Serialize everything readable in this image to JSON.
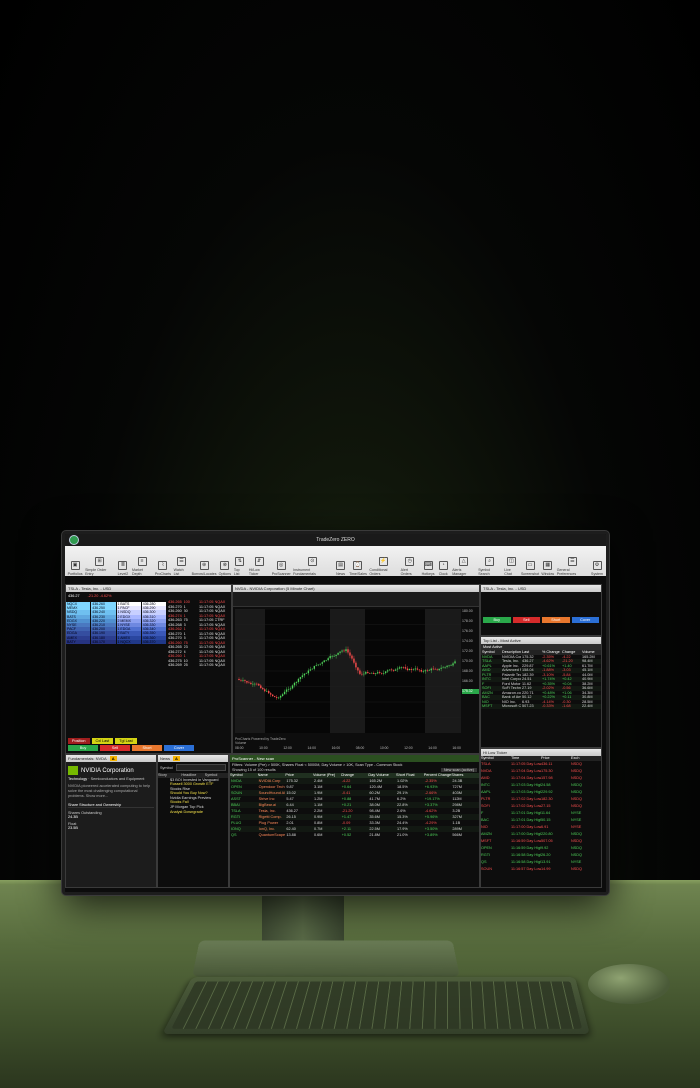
{
  "app": {
    "title": "TradeZero ZERO",
    "logo_color": "#2f9a4f"
  },
  "toolbar": [
    {
      "label": "Portfolios",
      "icon": "briefcase-icon",
      "glyph": "▣"
    },
    {
      "label": "Simple Order Entry",
      "icon": "order-entry-icon",
      "glyph": "⊞"
    },
    {
      "label": "Level2",
      "icon": "level2-icon",
      "glyph": "≣"
    },
    {
      "label": "Market Depth",
      "icon": "market-depth-icon",
      "glyph": "≡"
    },
    {
      "label": "ProCharts",
      "icon": "chart-icon",
      "glyph": "⌇"
    },
    {
      "label": "Watch List",
      "icon": "watchlist-icon",
      "glyph": "☰"
    },
    {
      "label": "Borrow/Locates",
      "icon": "locate-icon",
      "glyph": "⊕"
    },
    {
      "label": "Options",
      "icon": "options-icon",
      "glyph": "⊗"
    },
    {
      "label": "Top List",
      "icon": "toplist-icon",
      "glyph": "⇅"
    },
    {
      "label": "Hi/Low Ticker",
      "icon": "ticker-icon",
      "glyph": "⇵"
    },
    {
      "label": "ProScanner",
      "icon": "scanner-icon",
      "glyph": "◎"
    },
    {
      "label": "Instrument Fundamentals",
      "icon": "fundamentals-icon",
      "glyph": "⊙"
    },
    {
      "label": "News",
      "icon": "news-icon",
      "glyph": "▤"
    },
    {
      "label": "Time/Sales",
      "icon": "timesales-icon",
      "glyph": "⌚"
    },
    {
      "label": "Conditional Orders",
      "icon": "conditional-icon",
      "glyph": "⚡"
    },
    {
      "label": "Alert Orders",
      "icon": "alert-icon",
      "glyph": "◷"
    },
    {
      "label": "Hotkeys",
      "icon": "hotkeys-icon",
      "glyph": "⌨"
    },
    {
      "label": "Clock",
      "icon": "clock-icon",
      "glyph": "◔"
    },
    {
      "label": "Alerts Manager",
      "icon": "bell-icon",
      "glyph": "△"
    },
    {
      "label": "Symbol Search",
      "icon": "search-icon",
      "glyph": "⌕"
    },
    {
      "label": "Live Chat",
      "icon": "chat-icon",
      "glyph": "◫"
    },
    {
      "label": "Screenshot",
      "icon": "screenshot-icon",
      "glyph": "▭"
    },
    {
      "label": "Window",
      "icon": "window-icon",
      "glyph": "▦"
    },
    {
      "label": "General Preferences",
      "icon": "prefs-icon",
      "glyph": "☰"
    },
    {
      "label": "System",
      "icon": "system-icon",
      "glyph": "⚙"
    }
  ],
  "level2_left": {
    "title": "TSLA - Tesla, Inc. - USD",
    "price": "436.27",
    "change": "-21.20 -4.62%",
    "bid_venues": [
      "NQCX",
      "MEMX",
      "NSDQ",
      "BATS",
      "EDGX",
      "NYSE",
      "PACF",
      "EDGA",
      "AMEX",
      "BATY"
    ],
    "bid_prices": [
      "436.260",
      "436.250",
      "436.240",
      "436.230",
      "436.220",
      "436.210",
      "436.200",
      "436.190",
      "436.180",
      "436.170"
    ],
    "ask_venues": [
      "1 BATS",
      "1 PACF",
      "1 NSDQ",
      "2 EDGX",
      "2 MEMX",
      "1 NYSE",
      "1 EDGA",
      "2 BATY",
      "1 AMEX",
      "1 NQCX"
    ],
    "ask_prices": [
      "436.280",
      "436.290",
      "436.300",
      "436.310",
      "436.320",
      "436.330",
      "436.340",
      "436.350",
      "436.360",
      "436.370"
    ],
    "tape_prices": [
      "436.265",
      "436.270",
      "436.260",
      "436.274",
      "436.263",
      "436.268",
      "436.262",
      "436.270",
      "436.270",
      "436.260",
      "436.265",
      "436.272",
      "436.260",
      "436.275",
      "436.269"
    ],
    "tape_sizes": [
      "100",
      "1",
      "30",
      "1",
      "75",
      "3",
      "1",
      "1",
      "5",
      "75",
      "23",
      "4",
      "1",
      "10",
      "25"
    ],
    "tape_times": [
      "11:17:05",
      "11:17:05",
      "11:17:05",
      "11:17:05",
      "11:17:05",
      "11:17:05",
      "11:17:05",
      "11:17:05",
      "11:17:05",
      "11:17:05",
      "11:17:05",
      "11:17:05",
      "11:17:05",
      "11:17:05",
      "11:17:05"
    ],
    "tape_venues": [
      "NQAX",
      "NQAX",
      "NQAX",
      "NQAX",
      "CTRF",
      "NQAX",
      "NQAX",
      "NQAX",
      "NQAX",
      "NQAX",
      "NQAX",
      "NQAX",
      "NQAX",
      "NQAX",
      "NQAX"
    ],
    "buttons": {
      "position": "Position",
      "cxl_last": "Cxl Last",
      "tgl_last": "Tgl Last",
      "buy": "Buy",
      "sell": "Sell",
      "short": "Short",
      "cover": "Cover"
    }
  },
  "chart": {
    "title": "NVDA - NVIDIA Corporation (5 Minute Chart)",
    "study_label": "ProCharts Powered by TradeZero",
    "volume_label": "Volume",
    "y_ticks": [
      "180.00",
      "178.00",
      "176.00",
      "174.00",
      "172.00",
      "170.00",
      "168.00",
      "166.00"
    ],
    "last_price_tag": "175.32",
    "x_ticks": [
      "08:00",
      "10:00",
      "12:00",
      "14:00",
      "16:00",
      "08:00",
      "10:00",
      "12:00",
      "14:00",
      "16:00"
    ],
    "session_labels": [
      "(Pre-Market)",
      "(After Hours)",
      "(Pre-Market)",
      "(After Hours)"
    ]
  },
  "level2_right": {
    "title": "TSLA - Tesla, Inc. - USD",
    "buttons": {
      "buy": "Buy",
      "sell": "Sell",
      "short": "Short",
      "cover": "Cover"
    }
  },
  "toplist": {
    "title": "Top List - Most Active",
    "tab": "Most Active",
    "columns": [
      "Symbol",
      "Description",
      "Last",
      "% Change",
      "Change",
      "Volume"
    ],
    "rows": [
      [
        "NVDA",
        "NVIDIA Corporation",
        "175.32",
        "-2.35%",
        "-4.22",
        "165.2M"
      ],
      [
        "TSLA",
        "Tesla, Inc.",
        "436.27",
        "-4.62%",
        "-21.20",
        "98.4M"
      ],
      [
        "AAPL",
        "Apple Inc.",
        "229.87",
        "+0.61%",
        "+1.40",
        "61.7M"
      ],
      [
        "AMD",
        "Advanced Micro",
        "158.04",
        "-1.88%",
        "-3.03",
        "45.1M"
      ],
      [
        "PLTR",
        "Palantir Techn.",
        "182.39",
        "-3.10%",
        "-5.84",
        "44.0M"
      ],
      [
        "INTC",
        "Intel Corporation",
        "24.51",
        "+1.74%",
        "+0.42",
        "40.9M"
      ],
      [
        "F",
        "Ford Motor Co",
        "11.62",
        "+0.35%",
        "+0.04",
        "38.2M"
      ],
      [
        "SOFI",
        "SoFi Technologies",
        "27.19",
        "-2.02%",
        "-0.56",
        "36.6M"
      ],
      [
        "AMZN",
        "Amazon.com, Inc.",
        "220.71",
        "+0.48%",
        "+1.06",
        "34.3M"
      ],
      [
        "BAC",
        "Bank of America",
        "50.12",
        "+0.22%",
        "+0.11",
        "30.8M"
      ],
      [
        "NIO",
        "NIO Inc.",
        "6.93",
        "-4.14%",
        "-0.30",
        "28.5M"
      ],
      [
        "MSFT",
        "Microsoft Corp",
        "507.23",
        "-0.33%",
        "-1.68",
        "22.4M"
      ]
    ]
  },
  "fundamentals": {
    "title": "Fundamentals: NVDA",
    "symbol": "NVDA",
    "company": "NVIDIA Corporation",
    "sector": "Technology",
    "industry": "Semiconductors and Equipment",
    "desc": "NVIDIA pioneered accelerated computing to help solve the most challenging computational problems. Show more...",
    "share_section": "Share Structure and Ownership",
    "shares_label": "Shares Outstanding",
    "shares_value": "24.3B",
    "float_label": "Float",
    "float_value": "23.5B"
  },
  "news": {
    "title": "News",
    "symbol_label": "Symbol",
    "columns": [
      "Story",
      "Headline",
      "Symbol"
    ],
    "items": [
      "$3 BOI Invested in Vanguard",
      "Russell 3000 Growth ETF",
      "Stocks Rise",
      "Should You Buy Now?",
      "Nvidia Earnings Preview",
      "Stocks Fall",
      "JP Morgan Top Pick",
      "Analyst Downgrade"
    ]
  },
  "scanner": {
    "title": "ProScanner - New scan",
    "filters": "Filters: Volume (Pre) > 500K, Shares Float < 5000M, Day Volume > 10K, Scan Type - Common Stock",
    "results_label": "Showing 15 of 100 results",
    "save_label": "New scan (active)",
    "columns": [
      "Symbol",
      "Name",
      "Price",
      "Volume (Pre)",
      "Change",
      "Day Volume",
      "Short Float",
      "Percent Change",
      "Shares"
    ],
    "rows": [
      [
        "NVDA",
        "NVIDIA Corp",
        "175.32",
        "2.4M",
        "-4.22",
        "165.2M",
        "1.02%",
        "-2.35%",
        "24.3B"
      ],
      [
        "OPEN",
        "Opendoor Tech",
        "9.87",
        "3.1M",
        "+0.64",
        "120.4M",
        "18.5%",
        "+6.93%",
        "727M"
      ],
      [
        "SOUN",
        "SoundHound AI",
        "15.02",
        "1.9M",
        "-0.41",
        "60.2M",
        "29.1%",
        "-2.66%",
        "403M"
      ],
      [
        "ASST",
        "Strive Inc",
        "5.47",
        "1.2M",
        "+0.88",
        "41.7M",
        "6.2%",
        "+19.17%",
        "112M"
      ],
      [
        "BBAI",
        "BigBear.ai",
        "6.44",
        "1.1M",
        "+0.21",
        "38.0M",
        "22.8%",
        "+3.37%",
        "298M"
      ],
      [
        "TSLA",
        "Tesla, Inc.",
        "436.27",
        "2.2M",
        "-21.20",
        "98.4M",
        "2.6%",
        "-4.62%",
        "3.2B"
      ],
      [
        "RGTI",
        "Rigetti Comp.",
        "26.15",
        "0.9M",
        "+1.47",
        "35.6M",
        "15.3%",
        "+5.96%",
        "327M"
      ],
      [
        "PLUG",
        "Plug Power",
        "2.01",
        "0.8M",
        "-0.09",
        "33.3M",
        "24.4%",
        "-4.29%",
        "1.1B"
      ],
      [
        "IONQ",
        "IonQ, Inc.",
        "62.40",
        "0.7M",
        "+2.11",
        "22.5M",
        "17.9%",
        "+3.50%",
        "289M"
      ],
      [
        "QS",
        "QuantumScape",
        "13.88",
        "0.6M",
        "+0.52",
        "21.8M",
        "21.0%",
        "+3.89%",
        "566M"
      ]
    ]
  },
  "hilo": {
    "title": "Hi Low Ticker",
    "columns": [
      "Symbol",
      "Time",
      "Price",
      "Exch"
    ],
    "rows": [
      [
        "TSLA",
        "11:17:05 Day Low",
        "436.11",
        "NSDQ"
      ],
      [
        "NVDA",
        "11:17:04 Day Low",
        "175.30",
        "NSDQ"
      ],
      [
        "AMD",
        "11:17:04 Day Low",
        "157.98",
        "NSDQ"
      ],
      [
        "INTC",
        "11:17:03 Day High",
        "24.58",
        "NSDQ"
      ],
      [
        "AAPL",
        "11:17:03 Day High",
        "229.92",
        "NSDQ"
      ],
      [
        "PLTR",
        "11:17:02 Day Low",
        "182.30",
        "NSDQ"
      ],
      [
        "SOFI",
        "11:17:02 Day Low",
        "27.15",
        "NSDQ"
      ],
      [
        "F",
        "11:17:01 Day High",
        "11.64",
        "NYSE"
      ],
      [
        "BAC",
        "11:17:01 Day High",
        "50.15",
        "NYSE"
      ],
      [
        "NIO",
        "11:17:00 Day Low",
        "6.91",
        "NYSE"
      ],
      [
        "AMZN",
        "11:17:00 Day High",
        "220.80",
        "NSDQ"
      ],
      [
        "MSFT",
        "11:16:59 Day Low",
        "507.05",
        "NSDQ"
      ],
      [
        "OPEN",
        "11:16:59 Day High",
        "9.92",
        "NSDQ"
      ],
      [
        "RGTI",
        "11:16:58 Day High",
        "26.20",
        "NSDQ"
      ],
      [
        "QS",
        "11:16:58 Day High",
        "13.91",
        "NYSE"
      ],
      [
        "SOUN",
        "11:16:57 Day Low",
        "14.99",
        "NSDQ"
      ]
    ]
  },
  "colors": {
    "accent": "#f5b400",
    "buy": "#2aa84a",
    "sell": "#d62b2b",
    "short": "#e8772e",
    "cover": "#2b6fd6",
    "green_text": "#4fd35a",
    "red_text": "#ff5050"
  }
}
